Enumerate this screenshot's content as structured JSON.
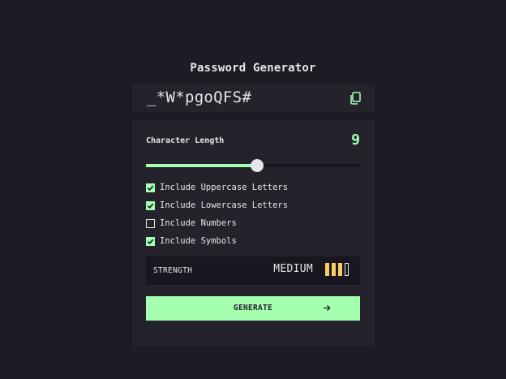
{
  "app": {
    "title": "Password Generator"
  },
  "password": {
    "value": "_*W*pgoQFS#",
    "copy_icon": "copy-icon"
  },
  "length": {
    "label": "Character Length",
    "value": "9",
    "fill_fraction": 0.52
  },
  "options": [
    {
      "label": "Include Uppercase Letters",
      "checked": true
    },
    {
      "label": "Include Lowercase Letters",
      "checked": true
    },
    {
      "label": "Include Numbers",
      "checked": false
    },
    {
      "label": "Include Symbols",
      "checked": true
    }
  ],
  "strength": {
    "label": "STRENGTH",
    "value": "MEDIUM",
    "level": 3,
    "max_level": 4
  },
  "generate": {
    "label": "GENERATE",
    "icon": "arrow-right-icon"
  },
  "colors": {
    "accent": "#a4ffaf",
    "strength_medium": "#f8cd65",
    "panel": "#24232c",
    "background": "#1d1c24"
  }
}
